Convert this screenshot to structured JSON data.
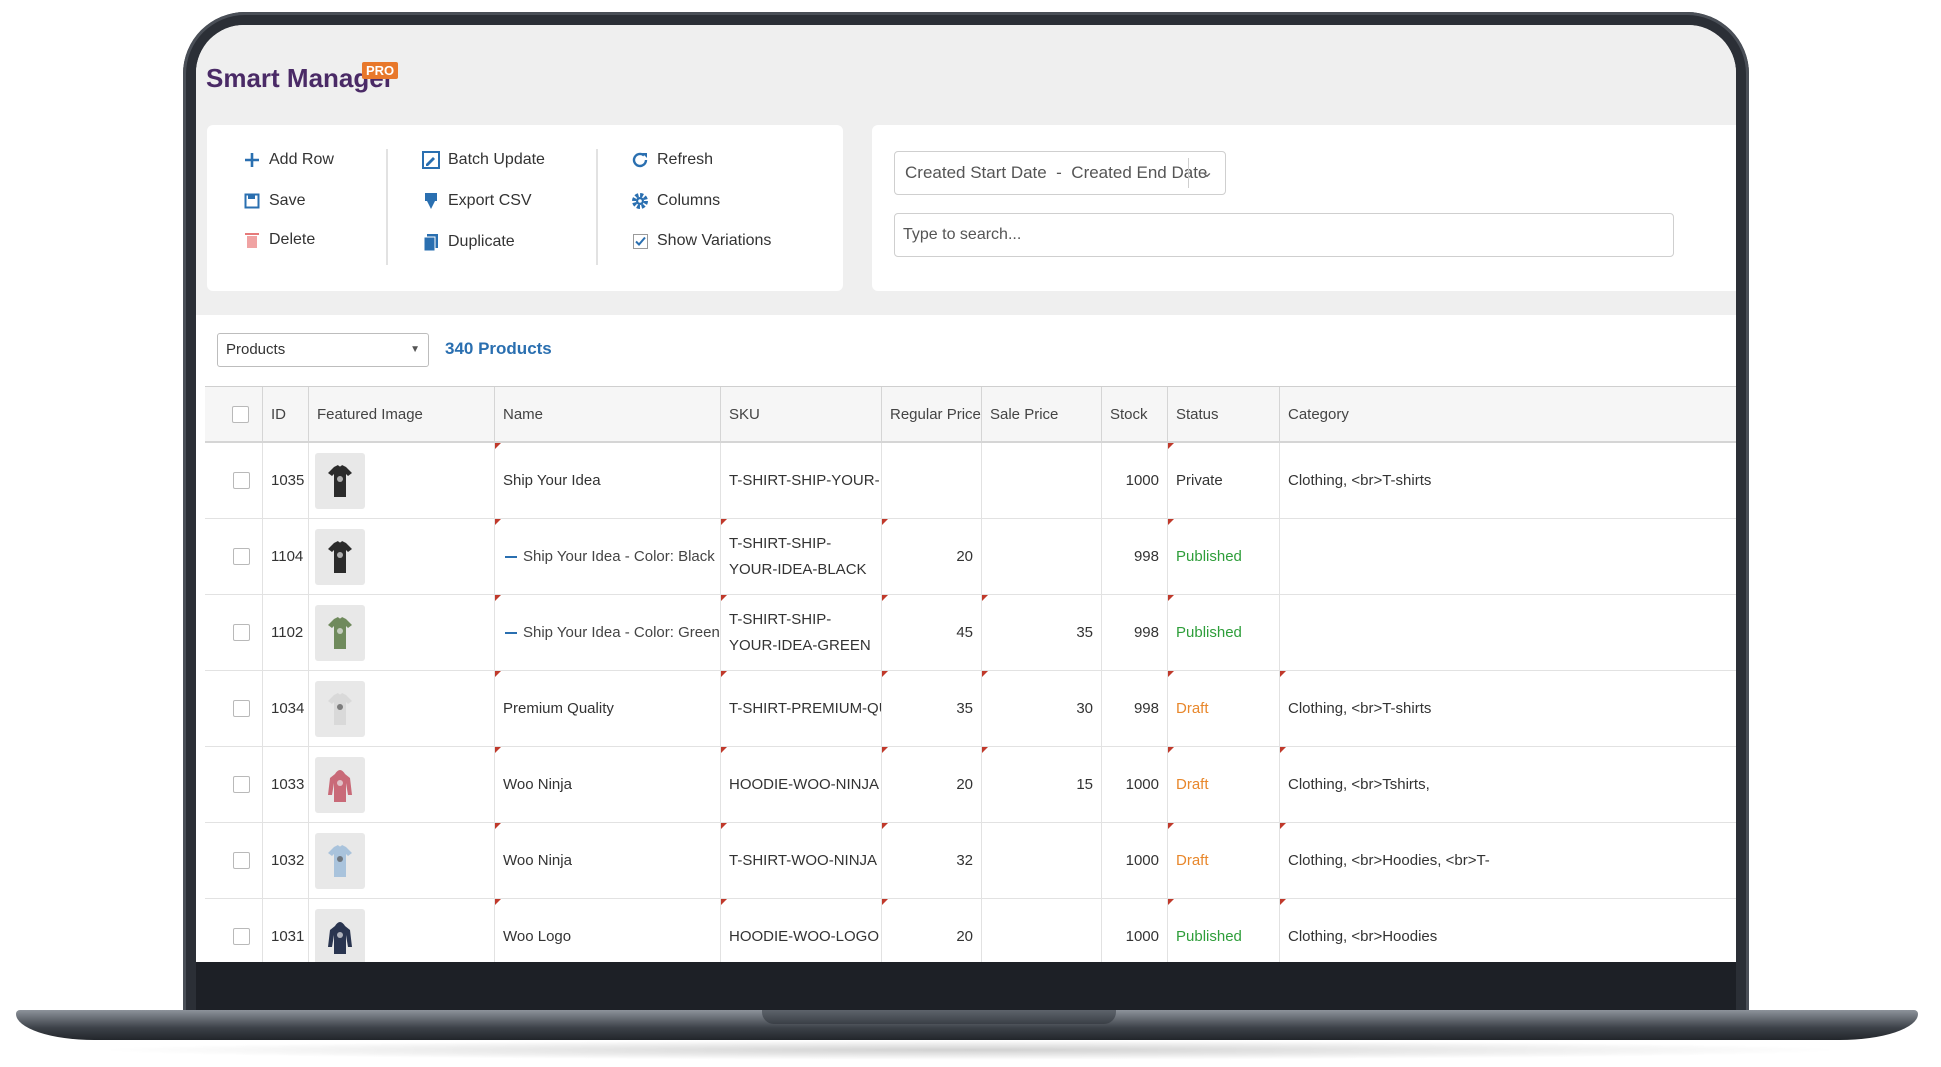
{
  "app": {
    "title": "Smart Manager",
    "badge": "PRO"
  },
  "toolbar": {
    "add_row": "Add Row",
    "save": "Save",
    "delete": "Delete",
    "batch_update": "Batch Update",
    "export_csv": "Export CSV",
    "duplicate": "Duplicate",
    "refresh": "Refresh",
    "columns": "Columns",
    "show_variations": "Show Variations",
    "show_variations_checked": true
  },
  "filter": {
    "date_range": "Created Start Date  -  Created End Date",
    "search_placeholder": "Type to search..."
  },
  "dashboard": {
    "selected": "Products",
    "count_label": "340 Products"
  },
  "colors": {
    "brand": "#4a2a66",
    "badge": "#e8782b",
    "link": "#2a6fb0",
    "published": "#2e9e3a",
    "draft": "#e8872b"
  },
  "grid": {
    "columns": [
      "ID",
      "Featured Image",
      "Name",
      "SKU",
      "Regular Price",
      "Sale Price",
      "Stock",
      "Status",
      "Category"
    ],
    "rows": [
      {
        "id": "1035",
        "image": "black-tshirt",
        "name": "Ship Your Idea",
        "variation": false,
        "sku": "T-SHIRT-SHIP-YOUR-IDEA",
        "regular_price": "",
        "sale_price": "",
        "stock": "1000",
        "status": "Private",
        "category": "Clothing, <br>T-shirts"
      },
      {
        "id": "1104",
        "image": "black-tshirt",
        "name": "Ship Your Idea - Color: Black",
        "variation": true,
        "sku": "T-SHIRT-SHIP-YOUR-IDEA-BLACK",
        "regular_price": "20",
        "sale_price": "",
        "stock": "998",
        "status": "Published",
        "category": ""
      },
      {
        "id": "1102",
        "image": "green-tshirt",
        "name": "Ship Your Idea - Color: Green",
        "variation": true,
        "sku": "T-SHIRT-SHIP-YOUR-IDEA-GREEN",
        "regular_price": "45",
        "sale_price": "35",
        "stock": "998",
        "status": "Published",
        "category": ""
      },
      {
        "id": "1034",
        "image": "white-tshirt",
        "name": "Premium Quality",
        "variation": false,
        "sku": "T-SHIRT-PREMIUM-QUALITY",
        "regular_price": "35",
        "sale_price": "30",
        "stock": "998",
        "status": "Draft",
        "category": "Clothing, <br>T-shirts"
      },
      {
        "id": "1033",
        "image": "pink-hoodie",
        "name": "Woo Ninja",
        "variation": false,
        "sku": "HOODIE-WOO-NINJA",
        "regular_price": "20",
        "sale_price": "15",
        "stock": "1000",
        "status": "Draft",
        "category": "Clothing, <br>Tshirts,"
      },
      {
        "id": "1032",
        "image": "blue-tshirt",
        "name": "Woo Ninja",
        "variation": false,
        "sku": "T-SHIRT-WOO-NINJA",
        "regular_price": "32",
        "sale_price": "",
        "stock": "1000",
        "status": "Draft",
        "category": "Clothing, <br>Hoodies, <br>T-"
      },
      {
        "id": "1031",
        "image": "navy-hoodie",
        "name": "Woo Logo",
        "variation": false,
        "sku": "HOODIE-WOO-LOGO",
        "regular_price": "20",
        "sale_price": "",
        "stock": "1000",
        "status": "Published",
        "category": "Clothing, <br>Hoodies"
      }
    ]
  }
}
